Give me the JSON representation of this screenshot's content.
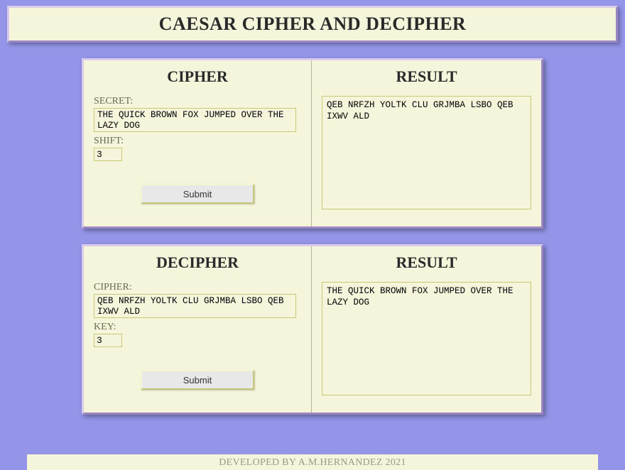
{
  "header": {
    "title": "CAESAR CIPHER AND DECIPHER"
  },
  "cipher": {
    "title": "CIPHER",
    "secret_label": "SECRET:",
    "secret_value": "THE QUICK BROWN FOX JUMPED OVER THE LAZY DOG",
    "shift_label": "SHIFT:",
    "shift_value": "3",
    "submit_label": "Submit",
    "result_title": "RESULT",
    "result_value": "QEB NRFZH YOLTK CLU GRJMBA LSBO QEB IXWV ALD"
  },
  "decipher": {
    "title": "DECIPHER",
    "cipher_label": "CIPHER:",
    "cipher_value": "QEB NRFZH YOLTK CLU GRJMBA LSBO QEB IXWV ALD",
    "key_label": "KEY:",
    "key_value": "3",
    "submit_label": "Submit",
    "result_title": "RESULT",
    "result_value": "THE QUICK BROWN FOX JUMPED OVER THE LAZY DOG"
  },
  "footer": {
    "text": "DEVELOPED BY A.M.HERNANDEZ 2021"
  }
}
